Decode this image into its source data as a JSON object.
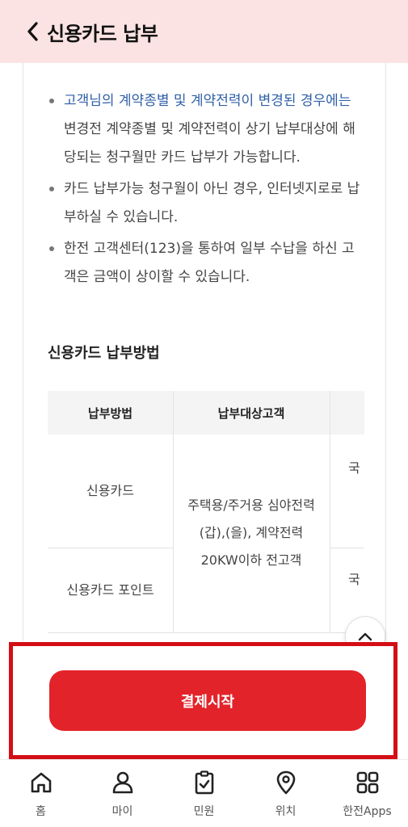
{
  "header": {
    "title": "신용카드 납부"
  },
  "notes": {
    "item1_highlight": "고객님의 계약종별 및 계약전력이 변경된 경우에는",
    "item1_rest": " 변경전 계약종별 및 계약전력이 상기 납부대상에 해당되는 청구월만 카드 납부가 가능합니다.",
    "item2": "카드 납부가능 청구월이 아닌 경우, 인터넷지로로 납부하실 수 있습니다.",
    "item3": "한전 고객센터(123)을 통하여 일부 수납을 하신 고객은 금액이 상이할 수 있습니다."
  },
  "section": {
    "title": "신용카드 납부방법"
  },
  "table": {
    "headers": [
      "납부방법",
      "납부대상고객"
    ],
    "rows": [
      {
        "method": "신용카드",
        "extra": "국"
      },
      {
        "method": "신용카드 포인트",
        "extra": "국"
      }
    ],
    "target": "주택용/주거용 심야전력(갑),(을), 계약전력 20KW이하 전고객"
  },
  "action": {
    "pay_label": "결제시작"
  },
  "tabbar": {
    "items": [
      {
        "label": "홈",
        "icon": "home-icon"
      },
      {
        "label": "마이",
        "icon": "user-icon"
      },
      {
        "label": "민원",
        "icon": "clipboard-check-icon"
      },
      {
        "label": "위치",
        "icon": "location-pin-icon"
      },
      {
        "label": "한전Apps",
        "icon": "apps-grid-icon"
      }
    ]
  },
  "colors": {
    "header_bg": "#fbe3e3",
    "accent_red": "#e3232a",
    "highlight_blue": "#2f5fa8"
  }
}
